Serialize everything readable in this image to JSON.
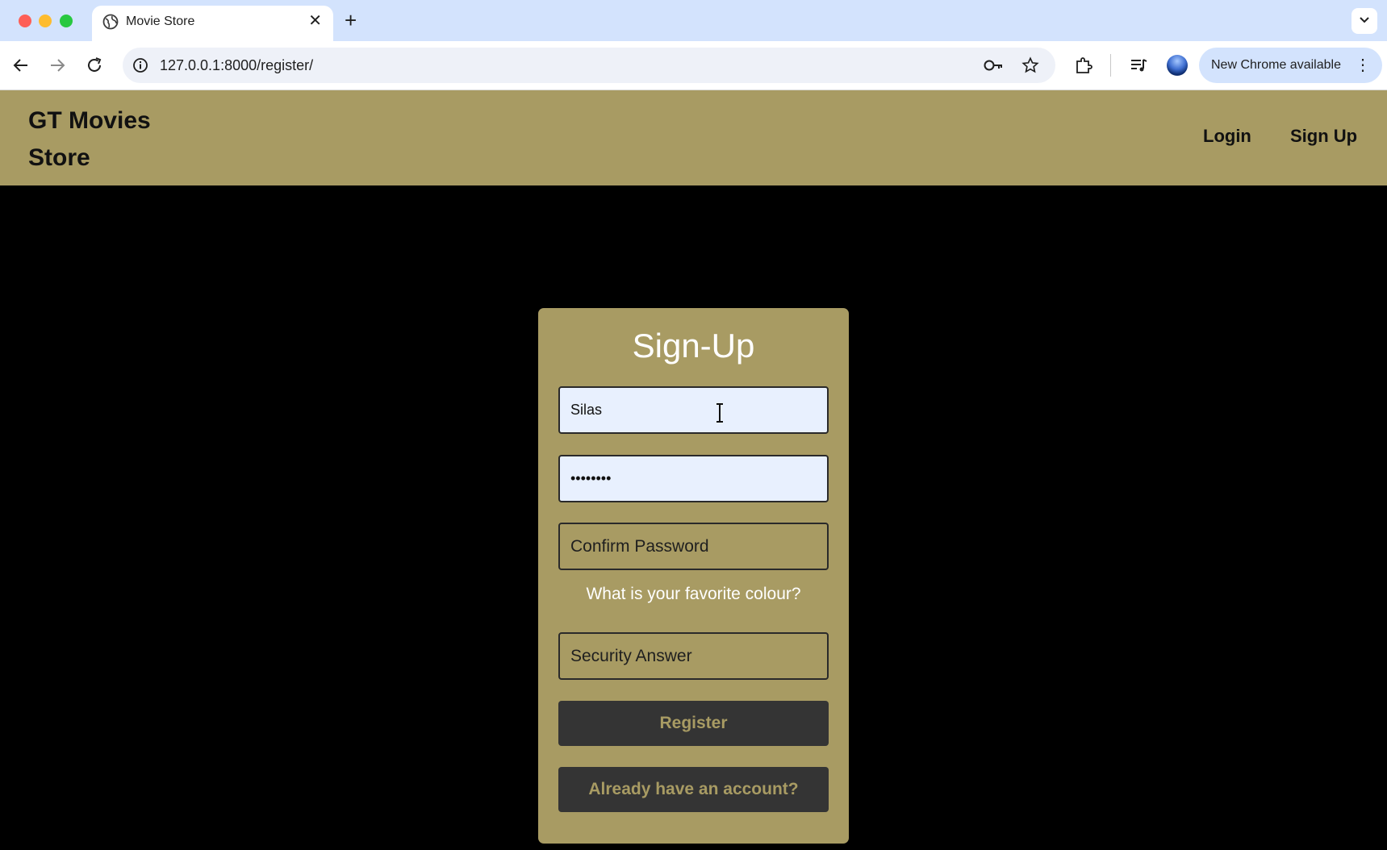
{
  "browser": {
    "tab_title": "Movie Store",
    "tab_close": "✕",
    "new_tab": "+",
    "url": "127.0.0.1:8000/register/",
    "update_label": "New Chrome available",
    "update_menu": "⋮"
  },
  "site": {
    "brand": "GT Movies Store",
    "nav": {
      "login": "Login",
      "signup": "Sign Up"
    }
  },
  "form": {
    "title": "Sign-Up",
    "username_value": "Silas",
    "password_value": "••••••••",
    "confirm_password_placeholder": "Confirm Password",
    "security_question": "What is your favorite colour?",
    "security_answer_placeholder": "Security Answer",
    "register_label": "Register",
    "login_link_label": "Already have an account?"
  },
  "colors": {
    "accent": "#a89b63",
    "button_bg": "#343434",
    "page_bg": "#000000"
  }
}
